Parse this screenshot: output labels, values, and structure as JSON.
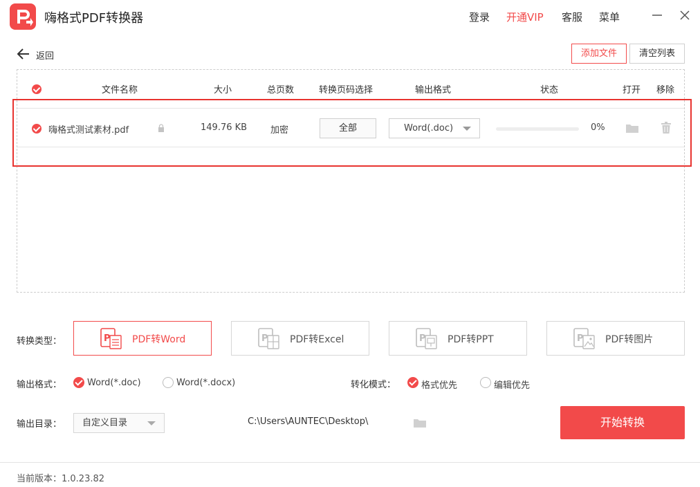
{
  "app": {
    "title": "嗨格式PDF转换器"
  },
  "nav": {
    "login": "登录",
    "vip": "开通VIP",
    "service": "客服",
    "menu": "菜单"
  },
  "toolbar": {
    "back": "返回",
    "add_file": "添加文件",
    "clear_list": "清空列表"
  },
  "table": {
    "headers": [
      "文件名称",
      "大小",
      "总页数",
      "转换页码选择",
      "输出格式",
      "状态",
      "打开",
      "移除"
    ],
    "rows": [
      {
        "name": "嗨格式测试素材.pdf",
        "size": "149.76 KB",
        "pages": "加密",
        "range": "全部",
        "format": "Word(.doc)",
        "progress_text": "0%",
        "progress": 0
      }
    ]
  },
  "conversion": {
    "label": "转换类型：",
    "types": [
      "PDF转Word",
      "PDF转Excel",
      "PDF转PPT",
      "PDF转图片"
    ],
    "active": 0
  },
  "output_format": {
    "label": "输出格式：",
    "options": [
      "Word(*.doc)",
      "Word(*.docx)"
    ],
    "selected": 0
  },
  "mode": {
    "label": "转化模式：",
    "options": [
      "格式优先",
      "编辑优先"
    ],
    "selected": 0
  },
  "output_dir": {
    "label": "输出目录：",
    "value": "自定义目录",
    "path": "C:\\Users\\AUNTEC\\Desktop\\"
  },
  "start_button": "开始转换",
  "footer": {
    "version": "当前版本：1.0.23.82"
  },
  "colors": {
    "accent": "#f24a4a"
  }
}
